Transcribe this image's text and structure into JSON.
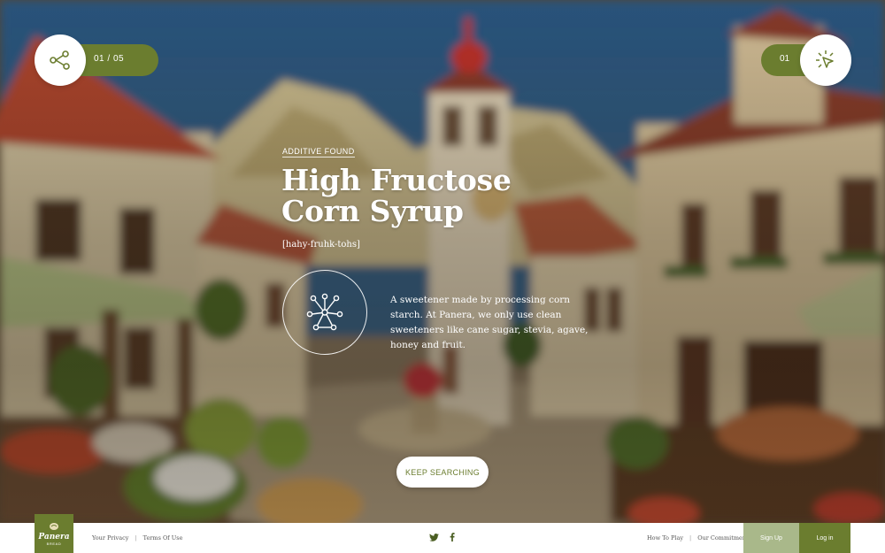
{
  "header": {
    "progress_label": "01 / 05",
    "right_counter": "01"
  },
  "icons": {
    "share": "share-icon",
    "cursor": "cursor-sparkle-icon",
    "molecule": "molecule-icon",
    "twitter": "twitter-icon",
    "facebook": "facebook-icon"
  },
  "content": {
    "eyebrow": "Additive Found",
    "title_line1": "High Fructose",
    "title_line2": "Corn Syrup",
    "pronunciation": "[hahy-fruhk-tohs]",
    "description": "A sweetener made by processing corn starch. At Panera, we only use clean sweeteners like cane sugar, stevia, agave, honey and fruit.",
    "cta": "Keep Searching"
  },
  "footer": {
    "logo_text": "Panera",
    "logo_sub": "BREAD",
    "privacy": "Your Privacy",
    "separator": "|",
    "terms": "Terms Of Use",
    "how_to_play": "How To Play",
    "commitment": "Our Commitment",
    "signup": "Sign Up",
    "login": "Log in"
  },
  "colors": {
    "brand_green": "#6b7d2f",
    "light_green": "#a9b88a",
    "sky": "#2f5a82"
  }
}
